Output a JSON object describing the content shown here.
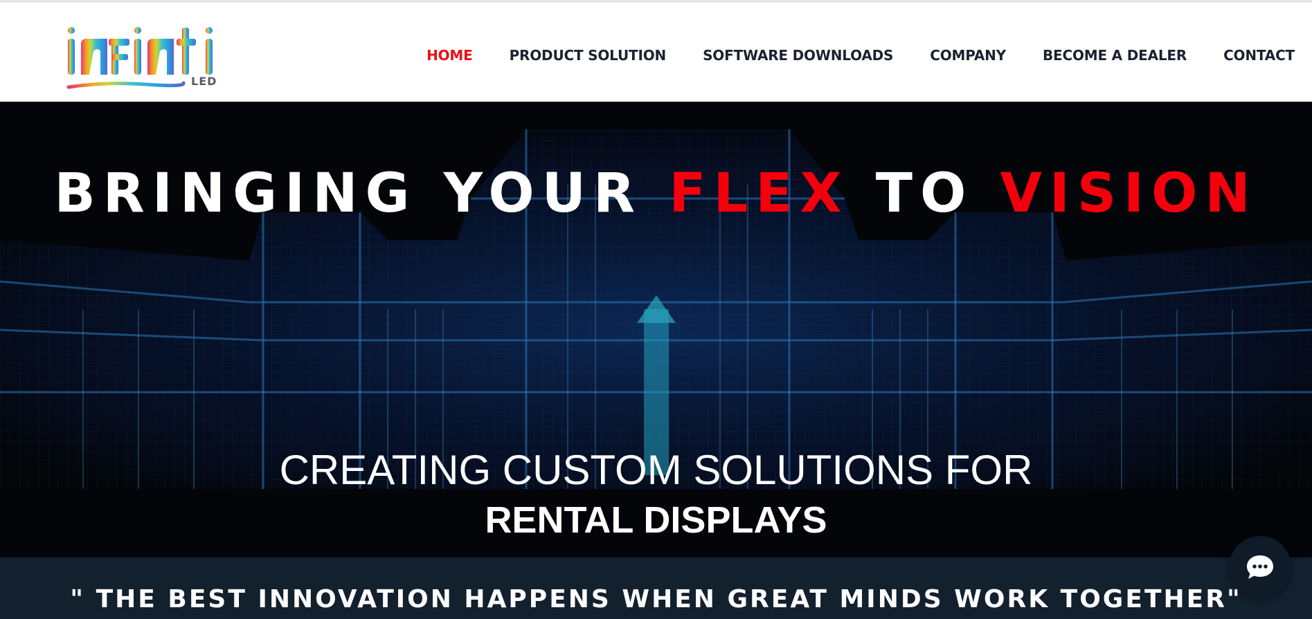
{
  "brand": {
    "logo_text": "INFINTI",
    "logo_suffix": "LED"
  },
  "nav": {
    "items": [
      {
        "label": "HOME",
        "active": true
      },
      {
        "label": "PRODUCT SOLUTION",
        "active": false
      },
      {
        "label": "SOFTWARE DOWNLOADS",
        "active": false
      },
      {
        "label": "COMPANY",
        "active": false
      },
      {
        "label": "BECOME A DEALER",
        "active": false
      },
      {
        "label": "CONTACT",
        "active": false
      }
    ]
  },
  "hero": {
    "title_part1": "BRINGING YOUR ",
    "title_part2": "FLEX",
    "title_part3": " TO ",
    "title_part4": "VISION",
    "subtitle_line1": "CREATING CUSTOM SOLUTIONS FOR",
    "subtitle_line2": "RENTAL DISPLAYS"
  },
  "quote": {
    "text": "\" THE BEST INNOVATION HAPPENS WHEN GREAT MINDS WORK TOGETHER\""
  },
  "chat": {
    "icon": "chat-bubble-icon"
  },
  "colors": {
    "accent_red": "#e8101b",
    "nav_text": "#1b2230",
    "hero_bg": "#06080f",
    "hero_light_blue": "#2f8bff",
    "quote_band": "#13202e"
  }
}
